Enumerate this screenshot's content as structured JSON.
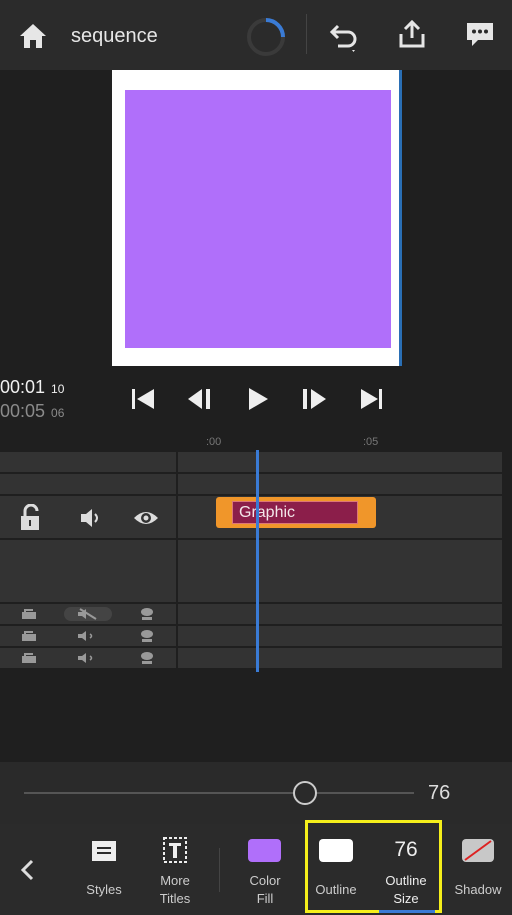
{
  "header": {
    "title": "sequence"
  },
  "preview": {
    "fill_color": "#b06ffa",
    "timecode_current": "00:01",
    "timecode_current_frames": "10",
    "timecode_total": "00:05",
    "timecode_total_frames": "06"
  },
  "timeline": {
    "ruler_marks": [
      ":00",
      ":05"
    ],
    "clip_label": "Graphic"
  },
  "slider": {
    "value_label": "76",
    "value_fraction": 0.72
  },
  "toolbar": {
    "styles_label": "Styles",
    "more_titles_label_1": "More",
    "more_titles_label_2": "Titles",
    "color_fill_label_1": "Color",
    "color_fill_label_2": "Fill",
    "outline_label": "Outline",
    "outline_size_value": "76",
    "outline_size_label_1": "Outline",
    "outline_size_label_2": "Size",
    "shadow_label": "Shadow"
  },
  "colors": {
    "accent": "#3a7bd5",
    "clip_outer": "#f0962a",
    "clip_inner": "#8b1e4a",
    "highlight": "#f5ef1b",
    "swatch_fill": "#b06ffa"
  }
}
